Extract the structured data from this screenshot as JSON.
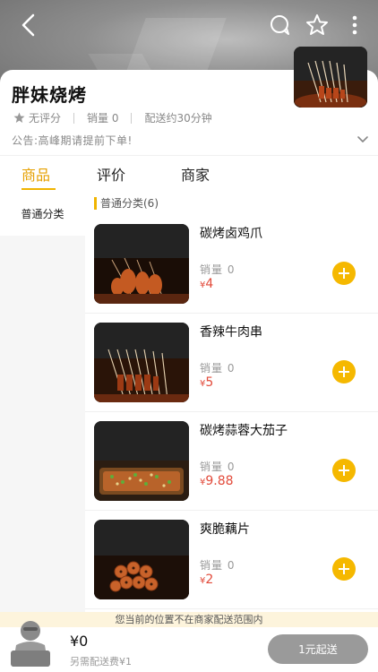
{
  "store": {
    "name": "胖妹烧烤",
    "rating_text": "无评分",
    "sales_text": "销量 0",
    "delivery_time": "配送约30分钟",
    "notice": "公告:高峰期请提前下单!"
  },
  "tabs": [
    {
      "label": "商品",
      "active": true
    },
    {
      "label": "评价",
      "active": false
    },
    {
      "label": "商家",
      "active": false
    }
  ],
  "sidebar": {
    "items": [
      {
        "label": "普通分类",
        "active": true
      }
    ]
  },
  "category": {
    "title": "普通分类(6)"
  },
  "products": [
    {
      "name": "碳烤卤鸡爪",
      "sales": "销量 0",
      "currency": "¥",
      "price": "4"
    },
    {
      "name": "香辣牛肉串",
      "sales": "销量 0",
      "currency": "¥",
      "price": "5"
    },
    {
      "name": "碳烤蒜蓉大茄子",
      "sales": "销量 0",
      "currency": "¥",
      "price": "9.88"
    },
    {
      "name": "爽脆藕片",
      "sales": "销量 0",
      "currency": "¥",
      "price": "2"
    }
  ],
  "footer": {
    "range_notice": "您当前的位置不在商家配送范围内",
    "cart_total": "¥0",
    "delivery_fee": "另需配送费¥1",
    "checkout_label": "1元起送"
  },
  "colors": {
    "accent": "#f0b400",
    "price": "#e24a3a",
    "checkout_disabled": "#9a9a9a"
  },
  "icons": [
    "back-icon",
    "chat-icon",
    "star-icon",
    "more-icon",
    "rating-star-icon",
    "chevron-down-icon",
    "plus-icon",
    "cart-icon"
  ]
}
